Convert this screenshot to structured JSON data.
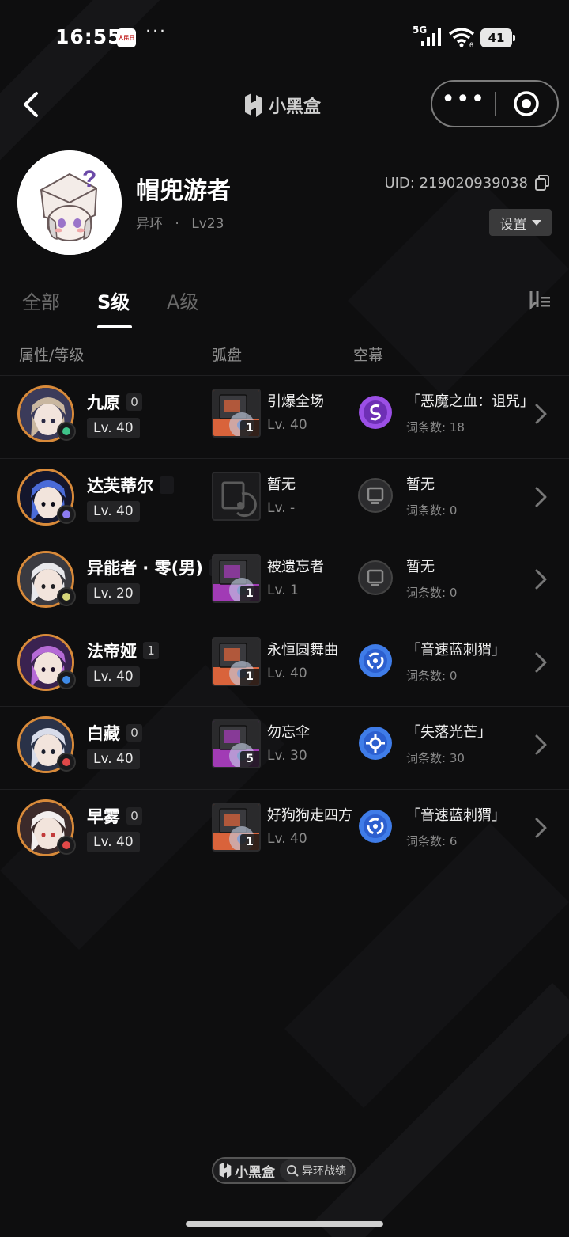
{
  "status_bar": {
    "time": "16:55",
    "app_badge": "人民日报",
    "more": "···",
    "network": "5G",
    "wifi_sub": "6",
    "battery": "41"
  },
  "nav": {
    "title": "小黑盒"
  },
  "profile": {
    "name": "帽兜游者",
    "game": "异环",
    "separator": "·",
    "level": "Lv23",
    "uid": "UID: 219020939038",
    "settings_label": "设置"
  },
  "tabs": [
    {
      "label": "全部",
      "active": false
    },
    {
      "label": "S级",
      "active": true
    },
    {
      "label": "A级",
      "active": false
    }
  ],
  "columns": {
    "attr": "属性/等级",
    "disc": "弧盘",
    "sky": "空幕"
  },
  "rows": [
    {
      "name": "九原",
      "num": "0",
      "lv": "Lv. 40",
      "element_color": "#3fc48a",
      "disc_name": "引爆全场",
      "disc_lv": "Lv. 40",
      "disc_count": "1",
      "disc_color": "#d9633b",
      "sky_name": "「恶魔之血：诅咒」",
      "sky_count": "词条数: 18",
      "sky_color": "#9b4fe6",
      "sky_icon": "s-sigil-icon"
    },
    {
      "name": "达芙蒂尔",
      "num": "",
      "lv": "Lv. 40",
      "element_color": "#8c7bf0",
      "disc_name": "暂无",
      "disc_lv": "Lv. -",
      "disc_count": "",
      "disc_color": "#1b1b1d",
      "sky_name": "暂无",
      "sky_count": "词条数: 0",
      "sky_color": "#2a2a2c",
      "sky_icon": "empty-screen-icon"
    },
    {
      "name": "异能者 · 零(男)",
      "num": "",
      "lv": "Lv. 20",
      "element_color": "#d6d67a",
      "disc_name": "被遗忘者",
      "disc_lv": "Lv. 1",
      "disc_count": "1",
      "disc_color": "#a13bb5",
      "sky_name": "暂无",
      "sky_count": "词条数: 0",
      "sky_color": "#2a2a2c",
      "sky_icon": "empty-screen-icon"
    },
    {
      "name": "法帝娅",
      "num": "1",
      "lv": "Lv. 40",
      "element_color": "#3f8be8",
      "disc_name": "永恒圆舞曲",
      "disc_lv": "Lv. 40",
      "disc_count": "1",
      "disc_color": "#d9633b",
      "sky_name": "「音速蓝刺猬」",
      "sky_count": "词条数: 0",
      "sky_color": "#3f7ce8",
      "sky_icon": "blue-ring-icon"
    },
    {
      "name": "白藏",
      "num": "0",
      "lv": "Lv. 40",
      "element_color": "#e04848",
      "disc_name": "勿忘伞",
      "disc_lv": "Lv. 30",
      "disc_count": "5",
      "disc_color": "#a13bb5",
      "sky_name": "「失落光芒」",
      "sky_count": "词条数: 30",
      "sky_color": "#3f7ce8",
      "sky_icon": "blue-gear-icon"
    },
    {
      "name": "早雾",
      "num": "0",
      "lv": "Lv. 40",
      "element_color": "#e04848",
      "disc_name": "好狗狗走四方",
      "disc_lv": "Lv. 40",
      "disc_count": "1",
      "disc_color": "#d9633b",
      "sky_name": "「音速蓝刺猬」",
      "sky_count": "词条数: 6",
      "sky_color": "#3f7ce8",
      "sky_icon": "blue-ring-icon"
    }
  ],
  "footer": {
    "brand": "小黑盒",
    "search_label": "异环战绩"
  }
}
